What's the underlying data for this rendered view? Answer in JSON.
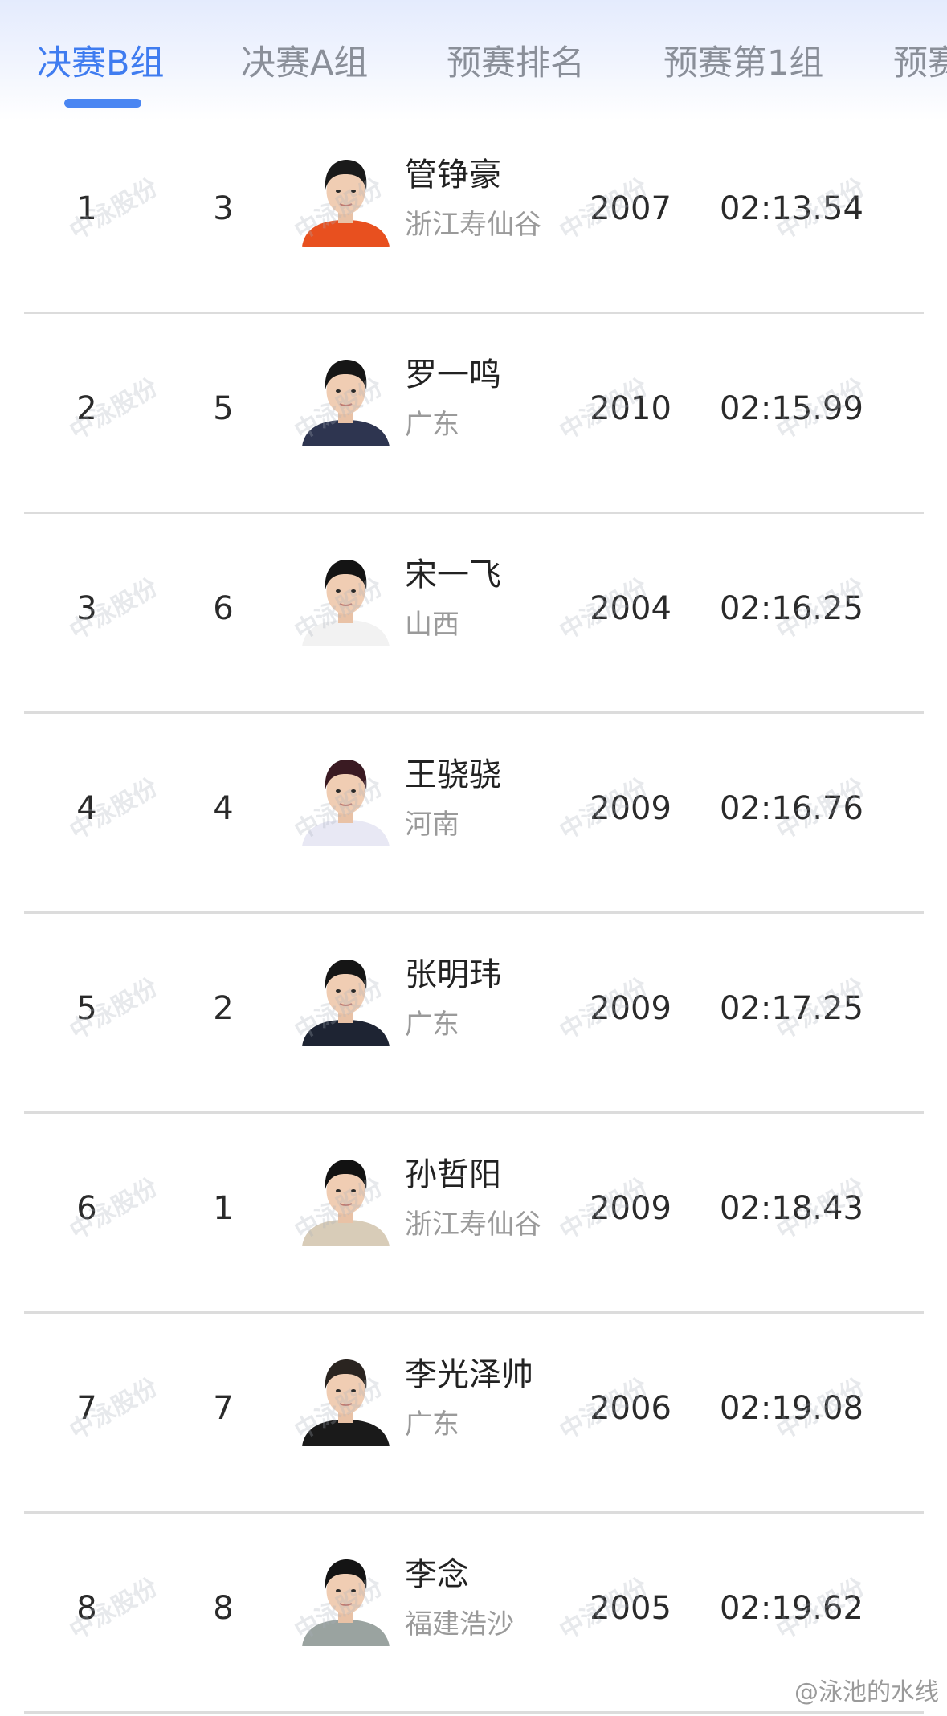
{
  "tabs": [
    {
      "label": "决赛B组",
      "active": true
    },
    {
      "label": "决赛A组",
      "active": false
    },
    {
      "label": "预赛排名",
      "active": false
    },
    {
      "label": "预赛第1组",
      "active": false
    },
    {
      "label": "预赛",
      "active": false
    }
  ],
  "rows": [
    {
      "rank": "1",
      "lane": "3",
      "name": "管铮豪",
      "team": "浙江寿仙谷",
      "year": "2007",
      "time": "02:13.54",
      "shirt": "#e8501f",
      "hair": "#1a1a1a",
      "bg": "#ffffff"
    },
    {
      "rank": "2",
      "lane": "5",
      "name": "罗一鸣",
      "team": "广东",
      "year": "2010",
      "time": "02:15.99",
      "shirt": "#2e3550",
      "hair": "#161616",
      "bg": "#ffffff"
    },
    {
      "rank": "3",
      "lane": "6",
      "name": "宋一飞",
      "team": "山西",
      "year": "2004",
      "time": "02:16.25",
      "shirt": "#f2f2f2",
      "hair": "#141414",
      "bg": "#ffffff"
    },
    {
      "rank": "4",
      "lane": "4",
      "name": "王骁骁",
      "team": "河南",
      "year": "2009",
      "time": "02:16.76",
      "shirt": "#e8e8f4",
      "hair": "#3a1a22",
      "bg": "#ffffff"
    },
    {
      "rank": "5",
      "lane": "2",
      "name": "张明玮",
      "team": "广东",
      "year": "2009",
      "time": "02:17.25",
      "shirt": "#1e2433",
      "hair": "#151515",
      "bg": "#ffffff"
    },
    {
      "rank": "6",
      "lane": "1",
      "name": "孙哲阳",
      "team": "浙江寿仙谷",
      "year": "2009",
      "time": "02:18.43",
      "shirt": "#d8ccb8",
      "hair": "#121212",
      "bg": "#ffffff"
    },
    {
      "rank": "7",
      "lane": "7",
      "name": "李光泽帅",
      "team": "广东",
      "year": "2006",
      "time": "02:19.08",
      "shirt": "#1a1a1a",
      "hair": "#2a2420",
      "bg": "#ffffff"
    },
    {
      "rank": "8",
      "lane": "8",
      "name": "李念",
      "team": "福建浩沙",
      "year": "2005",
      "time": "02:19.62",
      "shirt": "#9aa3a0",
      "hair": "#141414",
      "bg": "#ffffff"
    }
  ],
  "watermark_text": "中泳股份",
  "credit": "@泳池的水线"
}
